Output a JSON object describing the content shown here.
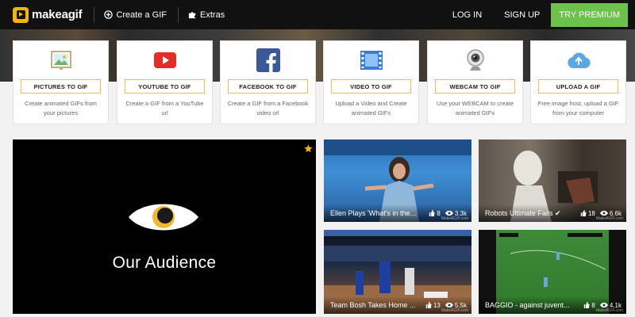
{
  "nav": {
    "logo_text": "makeagif",
    "create_label": "Create a GIF",
    "extras_label": "Extras",
    "login_label": "LOG IN",
    "signup_label": "SIGN UP",
    "premium_label": "TRY PREMIUM",
    "premium_color": "#6cc24a"
  },
  "tiles": [
    {
      "icon": "picture-icon",
      "button": "PICTURES TO GIF",
      "desc": "Create animated GIFs from your pictures"
    },
    {
      "icon": "youtube-icon",
      "button": "YOUTUBE TO GIF",
      "desc": "Create a GIF from a YouTube url"
    },
    {
      "icon": "facebook-icon",
      "button": "FACEBOOK TO GIF",
      "desc": "Create a GIF from a Facebook video url"
    },
    {
      "icon": "film-icon",
      "button": "VIDEO TO GIF",
      "desc": "Upload a Video and Create animated GIFs"
    },
    {
      "icon": "webcam-icon",
      "button": "WEBCAM TO GIF",
      "desc": "Use your WEBCAM to create animated GIFs"
    },
    {
      "icon": "upload-cloud-icon",
      "button": "UPLOAD A GIF",
      "desc": "Free image host, upload a GIF from your computer"
    }
  ],
  "feature": {
    "title": "Our Audience"
  },
  "thumbs": [
    {
      "title": "Ellen Plays 'What's in the...",
      "likes": "8",
      "views": "3.3k",
      "watermark": "MakeAGIF.com"
    },
    {
      "title": "Robots Ultimate Fails ✔",
      "likes": "18",
      "views": "6.6k",
      "watermark": "MakeAGIF.com"
    },
    {
      "title": "Team Bosh Takes Home ...",
      "likes": "13",
      "views": "5.5k",
      "watermark": "MakeAGIF.com"
    },
    {
      "title": "BAGGIO - against juvent...",
      "likes": "8",
      "views": "4.1k",
      "watermark": "MakeAGIF.com"
    }
  ]
}
